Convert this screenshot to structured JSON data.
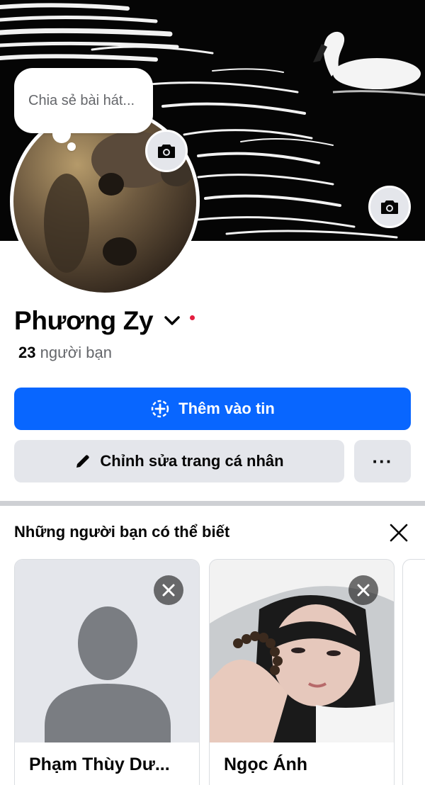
{
  "profile": {
    "name": "Phương Zy",
    "friend_count": "23",
    "friend_label": "người bạn",
    "note_placeholder": "Chia sẻ bài hát..."
  },
  "actions": {
    "add_story_label": "Thêm vào tin",
    "edit_profile_label": "Chỉnh sửa trang cá nhân",
    "more_label": "···"
  },
  "pymk": {
    "title": "Những người bạn có thể biết",
    "suggestions": [
      {
        "name": "Phạm Thùy Dư..."
      },
      {
        "name": "Ngọc Ánh"
      }
    ]
  },
  "colors": {
    "primary": "#0866ff",
    "secondary_button": "#e4e6eb",
    "online_dot": "#e41e3f"
  },
  "icons": [
    "camera-icon",
    "chevron-down-icon",
    "add-story-icon",
    "pencil-icon",
    "more-icon",
    "close-icon"
  ]
}
